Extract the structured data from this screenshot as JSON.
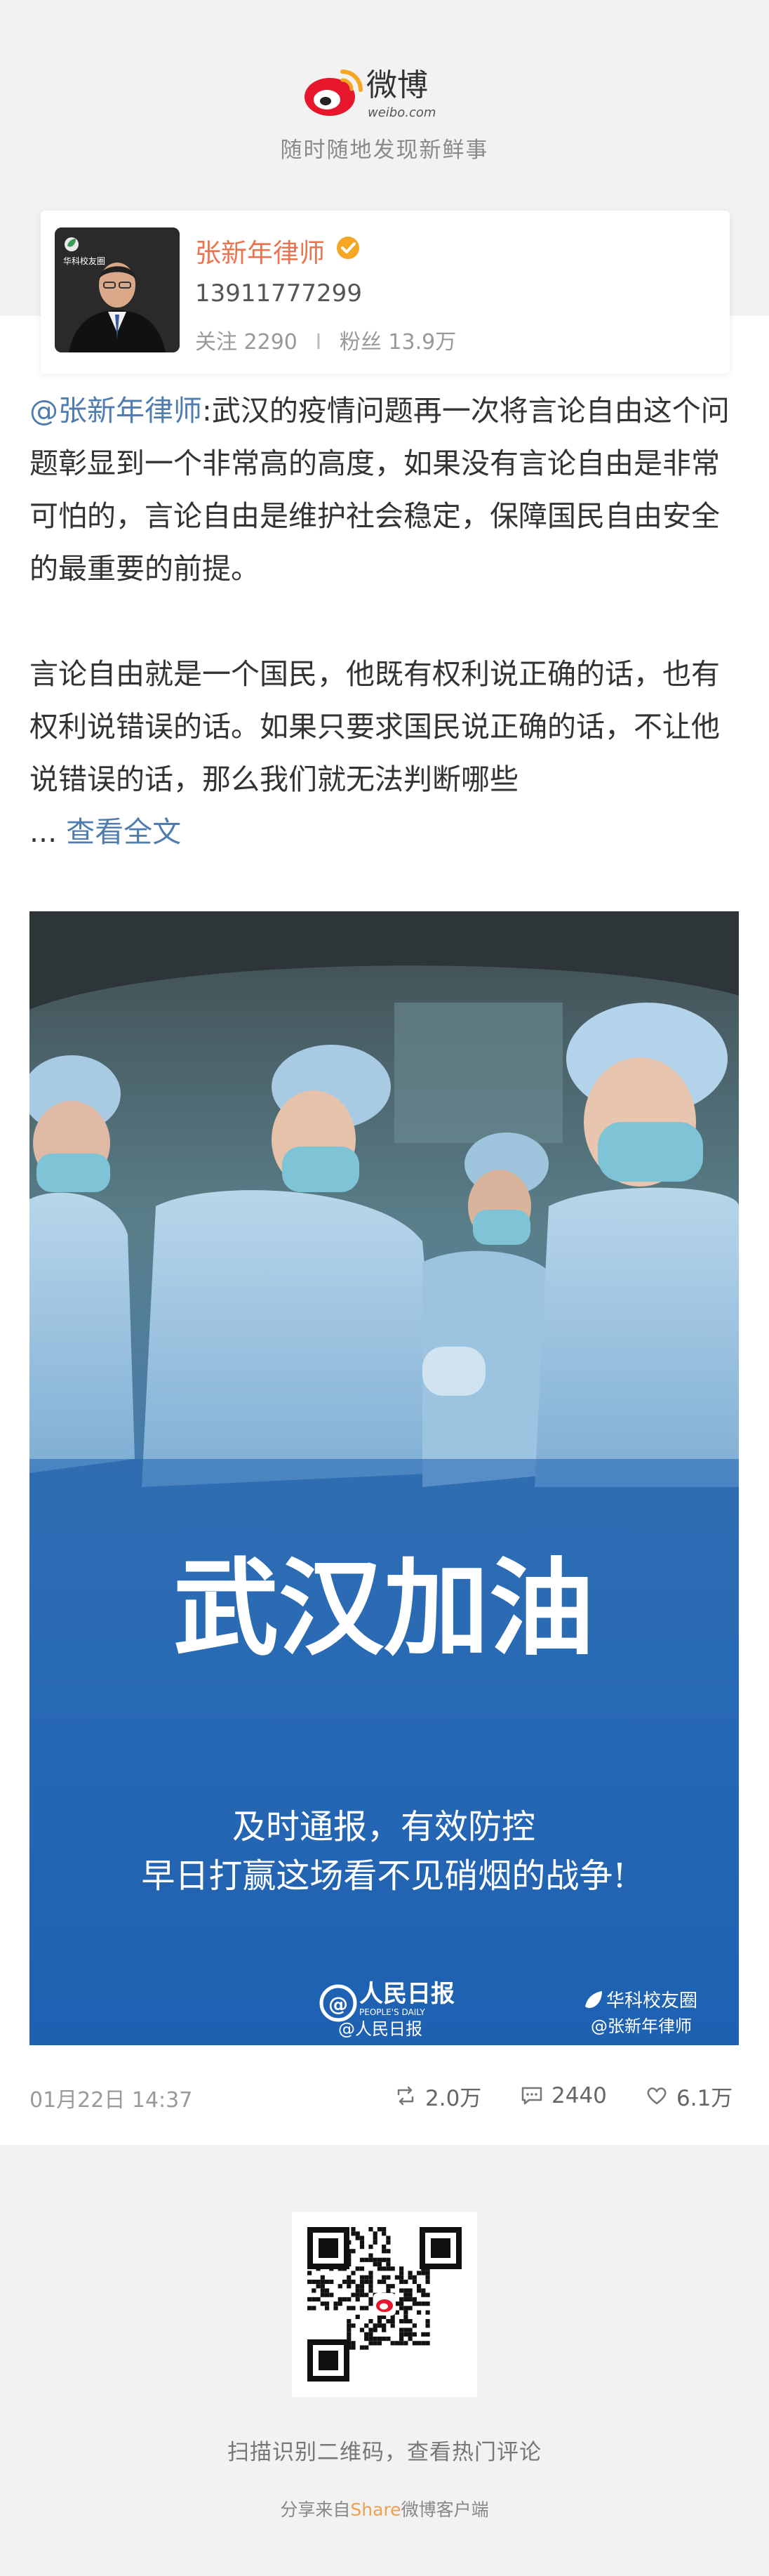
{
  "header": {
    "logo_text": "微博",
    "logo_subtext": "weibo.com",
    "tagline": "随时随地发现新鲜事"
  },
  "profile": {
    "name": "张新年律师",
    "phone": "13911777299",
    "following_label": "关注",
    "following_count": "2290",
    "separator": "I",
    "followers_label": "粉丝",
    "followers_count": "13.9万",
    "avatar_badge": "华科校友圈"
  },
  "post": {
    "mention": "@张新年律师",
    "paragraph1": ":武汉的疫情问题再一次将言论自由这个问题彰显到一个非常高的高度，如果没有言论自由是非常可怕的，言论自由是维护社会稳定，保障国民自由安全的最重要的前提。",
    "paragraph2": "言论自由就是一个国民，他既有权利说正确的话，也有权利说错误的话。如果只要求国民说正确的话，不让他说错误的话，那么我们就无法判断哪些",
    "ellipsis": "... ",
    "more_label": "查看全文",
    "image": {
      "headline": "武汉加油",
      "line1": "及时通报，有效防控",
      "line2": "早日打赢这场看不见硝烟的战争!",
      "source_logo": "人民日报",
      "source_logo_en": "PEOPLE'S DAILY",
      "source_handle": "@人民日报",
      "right_brand": "华科校友圈",
      "right_handle": "@张新年律师"
    },
    "timestamp": "01月22日 14:37",
    "reposts": "2.0万",
    "comments": "2440",
    "likes": "6.1万"
  },
  "footer": {
    "qr_caption": "扫描识别二维码，查看热门评论",
    "share_prefix": "分享来自",
    "share_word": "Share",
    "share_suffix": "微博客户端"
  },
  "colors": {
    "accent_orange": "#eb7350",
    "link_blue": "#507daf",
    "band_gray": "#f2f2f2",
    "verify_gold": "#f5a623",
    "weibo_red": "#e6162d"
  }
}
